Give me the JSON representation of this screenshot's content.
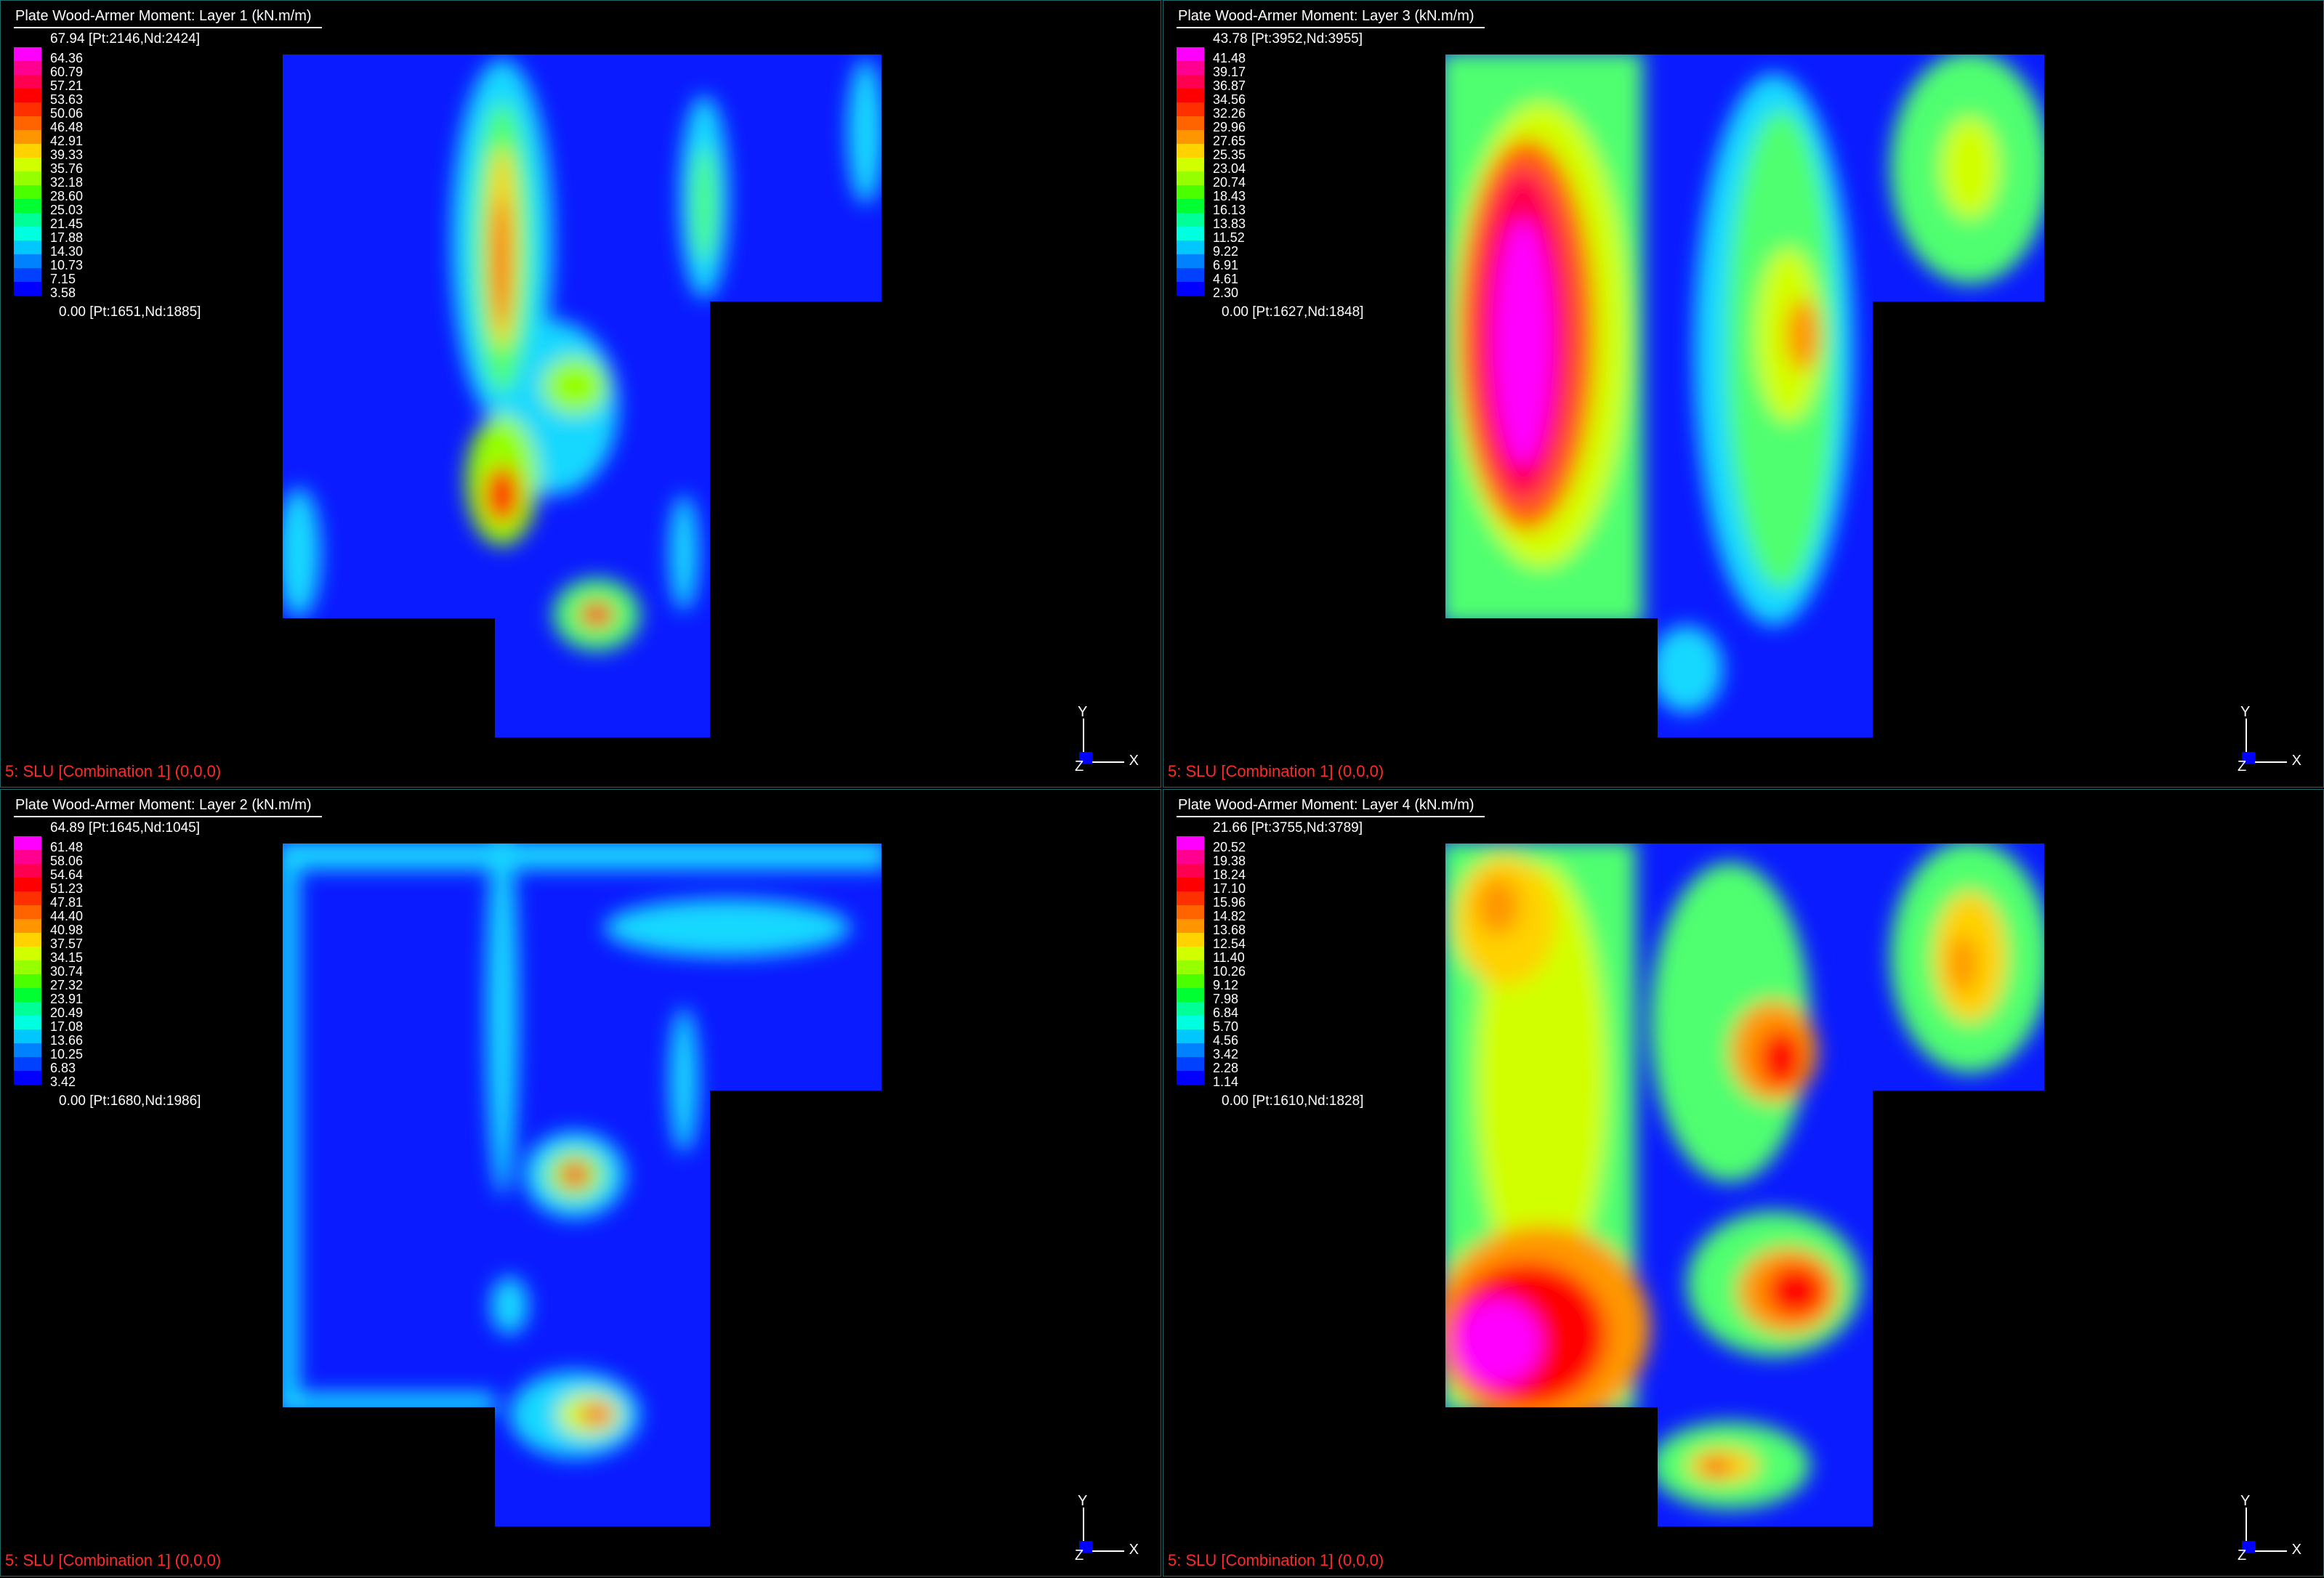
{
  "status_label": "5: SLU [Combination 1] (0,0,0)",
  "axes": {
    "y": "Y",
    "x": "X",
    "z": "Z"
  },
  "scale_colors": [
    "#ff00ff",
    "#ff0090",
    "#ff0050",
    "#ff0000",
    "#ff3000",
    "#ff6400",
    "#ff9600",
    "#ffd200",
    "#d2ff00",
    "#96ff00",
    "#4bff00",
    "#00ff32",
    "#00ff96",
    "#00ffe1",
    "#00c8ff",
    "#0082ff",
    "#0040ff",
    "#0000ff"
  ],
  "panels": [
    {
      "title": "Plate Wood-Armer Moment: Layer 1  (kN.m/m)",
      "max": "67.94 [Pt:2146,Nd:2424]",
      "min": "0.00 [Pt:1651,Nd:1885]",
      "ticks": [
        "64.36",
        "60.79",
        "57.21",
        "53.63",
        "50.06",
        "46.48",
        "42.91",
        "39.33",
        "35.76",
        "32.18",
        "28.60",
        "25.03",
        "21.45",
        "17.88",
        "14.30",
        "10.73",
        "7.15",
        "3.58"
      ]
    },
    {
      "title": "Plate Wood-Armer Moment: Layer 3  (kN.m/m)",
      "max": "43.78 [Pt:3952,Nd:3955]",
      "min": "0.00 [Pt:1627,Nd:1848]",
      "ticks": [
        "41.48",
        "39.17",
        "36.87",
        "34.56",
        "32.26",
        "29.96",
        "27.65",
        "25.35",
        "23.04",
        "20.74",
        "18.43",
        "16.13",
        "13.83",
        "11.52",
        "9.22",
        "6.91",
        "4.61",
        "2.30"
      ]
    },
    {
      "title": "Plate Wood-Armer Moment: Layer 2  (kN.m/m)",
      "max": "64.89 [Pt:1645,Nd:1045]",
      "min": "0.00 [Pt:1680,Nd:1986]",
      "ticks": [
        "61.48",
        "58.06",
        "54.64",
        "51.23",
        "47.81",
        "44.40",
        "40.98",
        "37.57",
        "34.15",
        "30.74",
        "27.32",
        "23.91",
        "20.49",
        "17.08",
        "13.66",
        "10.25",
        "6.83",
        "3.42"
      ]
    },
    {
      "title": "Plate Wood-Armer Moment: Layer 4  (kN.m/m)",
      "max": "21.66 [Pt:3755,Nd:3789]",
      "min": "0.00 [Pt:1610,Nd:1828]",
      "ticks": [
        "20.52",
        "19.38",
        "18.24",
        "17.10",
        "15.96",
        "14.82",
        "13.68",
        "12.54",
        "11.40",
        "10.26",
        "9.12",
        "7.98",
        "6.84",
        "5.70",
        "4.56",
        "3.42",
        "2.28",
        "1.14"
      ]
    }
  ]
}
